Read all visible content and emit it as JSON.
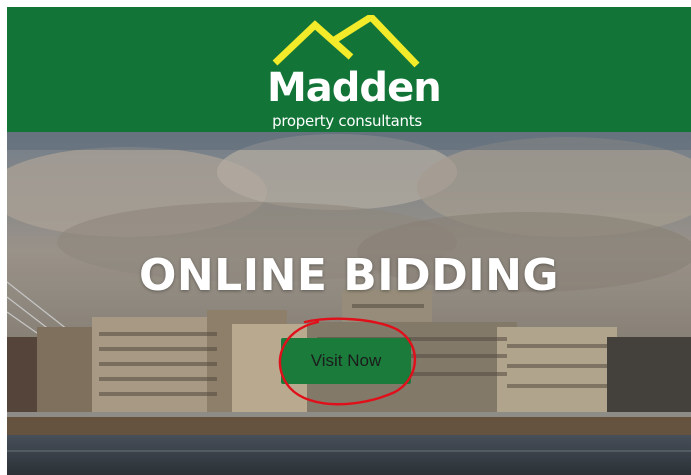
{
  "brand": {
    "name": "Madden",
    "tagline": "property consultants",
    "header_color": "#127437",
    "roof_color": "#f3ea2a"
  },
  "hero": {
    "title": "ONLINE BIDDING",
    "button_label": "Visit Now",
    "button_color": "#1a7b3b"
  },
  "annotation": {
    "shape": "hand-drawn circle",
    "color": "#e0101a"
  }
}
